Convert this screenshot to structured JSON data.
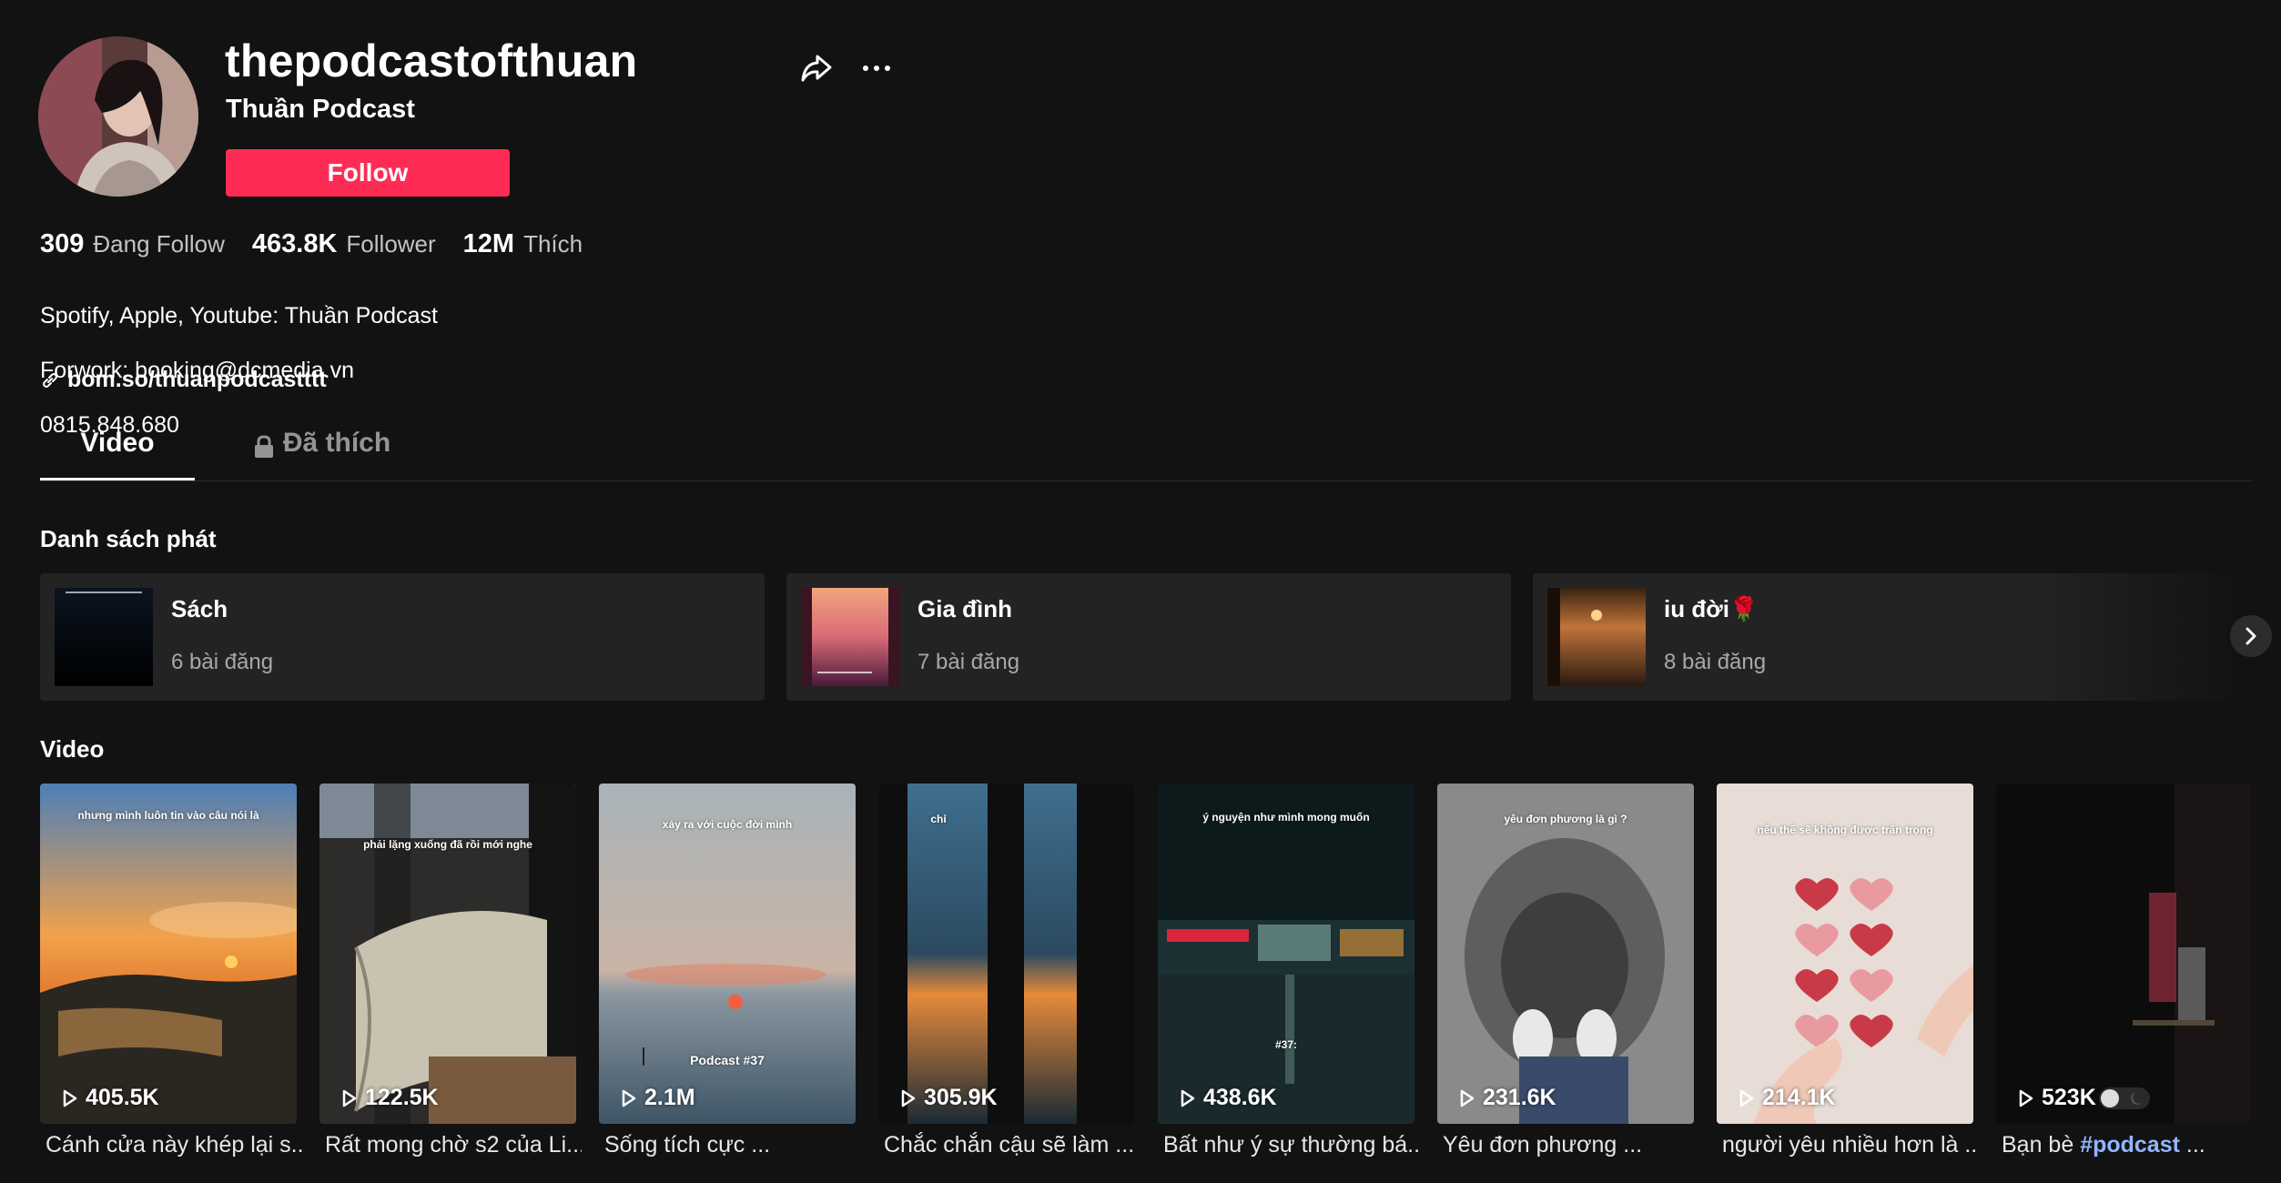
{
  "profile": {
    "username": "thepodcastofthuan",
    "nickname": "Thuần Podcast",
    "follow_label": "Follow",
    "stats": [
      {
        "value": "309",
        "label": "Đang Follow"
      },
      {
        "value": "463.8K",
        "label": "Follower"
      },
      {
        "value": "12M",
        "label": "Thích"
      }
    ],
    "bio": [
      "Spotify, Apple, Youtube: Thuần Podcast",
      "Forwork: booking@dcmedia.vn",
      "0815.848.680"
    ],
    "link": "bom.so/thuanpodcastttt"
  },
  "tabs": [
    {
      "label": "Video",
      "active": true
    },
    {
      "label": "Đã thích",
      "active": false,
      "icon": "lock-icon"
    }
  ],
  "playlists_section": {
    "title": "Danh sách phát",
    "items": [
      {
        "name": "Sách",
        "count": "6 bài đăng"
      },
      {
        "name": "Gia đình",
        "count": "7 bài đăng"
      },
      {
        "name": "iu đời🌹",
        "count": "8 bài đăng"
      }
    ]
  },
  "videos_section": {
    "title": "Video",
    "items": [
      {
        "views": "405.5K",
        "caption": "Cánh cửa này khép lại s...",
        "overlay": "nhưng mình luôn tin vào câu nói là"
      },
      {
        "views": "122.5K",
        "caption": "Rất mong chờ s2 của Li...",
        "overlay": "phải lặng xuống đã rồi mới nghe"
      },
      {
        "views": "2.1M",
        "caption": "Sống tích cực ...",
        "overlay": "xảy ra với cuộc đời mình",
        "overlay2": "Podcast #37"
      },
      {
        "views": "305.9K",
        "caption": "Chắc chắn cậu sẽ làm ...",
        "overlay": "chỉ"
      },
      {
        "views": "438.6K",
        "caption": "Bất như ý sự thường bá...",
        "overlay": "ý nguyện như mình mong muốn",
        "overlay2": "#37:"
      },
      {
        "views": "231.6K",
        "caption": "Yêu đơn phương ...",
        "overlay": "yêu đơn phương là gì ?"
      },
      {
        "views": "214.1K",
        "caption": "người yêu nhiều hơn là ...",
        "overlay": "nếu thế sẽ không được trân trọng"
      },
      {
        "views": "523K",
        "caption_text": "Bạn bè ",
        "caption_tag": "#podcast",
        "caption_end": " ..."
      }
    ]
  }
}
